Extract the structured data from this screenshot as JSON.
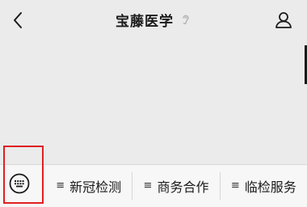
{
  "header": {
    "title": "宝藤医学",
    "back_icon": "chevron-left-icon",
    "ear_icon": "ear-icon",
    "profile_icon": "person-icon"
  },
  "bottom_menu": {
    "keyboard_icon": "keyboard-icon",
    "items": [
      {
        "glyph": "≡",
        "label": "新冠检测"
      },
      {
        "glyph": "≡",
        "label": "商务合作"
      },
      {
        "glyph": "≡",
        "label": "临检服务"
      }
    ],
    "highlight_color": "#e02020"
  }
}
